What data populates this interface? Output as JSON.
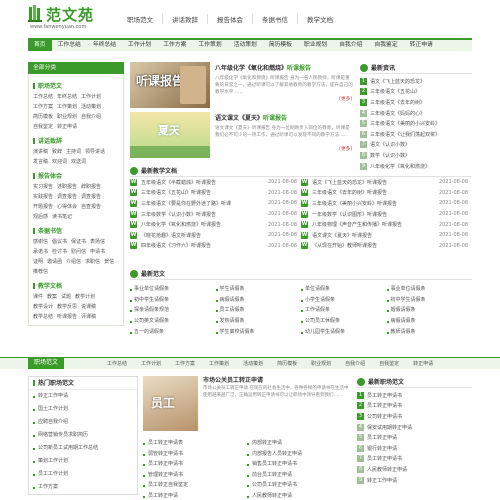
{
  "site": {
    "logo_text": "范文苑",
    "url": "www.fanwenyuan.com"
  },
  "top_nav": [
    "职场范文",
    "讲话致辞",
    "报告体会",
    "条据书信",
    "教学文档"
  ],
  "main_nav": [
    "首页",
    "工作总结",
    "年终总结",
    "工作计划",
    "工作方案",
    "工作策划",
    "活动策划",
    "简历模板",
    "职业规划",
    "自我介绍",
    "自我鉴定",
    "转正申请"
  ],
  "sidebar": {
    "header": "全部分类",
    "categories": [
      {
        "title": "职场范文",
        "items": [
          "工作总结",
          "年终总结",
          "工作计划",
          "工作方案",
          "工作策划",
          "活动策划",
          "简历模板",
          "职业规划",
          "自我介绍",
          "自我鉴定",
          "转正申请"
        ]
      },
      {
        "title": "讲话致辞",
        "items": [
          "演讲稿",
          "致辞",
          "主持词",
          "领导讲话",
          "发言稿",
          "欢迎词",
          "欢送词"
        ]
      },
      {
        "title": "报告体会",
        "items": [
          "实习报告",
          "述职报告",
          "辞职报告",
          "实践报告",
          "调查报告",
          "调查报告",
          "开题报告",
          "心得体会",
          "自查报告",
          "观后感",
          "读书笔记"
        ]
      },
      {
        "title": "条据书信",
        "items": [
          "感谢信",
          "倡议书",
          "保证书",
          "表扬信",
          "承诺书",
          "检讨书",
          "慰问信",
          "申请书",
          "证明",
          "邀请函",
          "介绍信",
          "求职信",
          "贺信",
          "推荐信"
        ]
      },
      {
        "title": "教学文档",
        "items": [
          "课件",
          "教案",
          "试题",
          "教学计划",
          "教学设计",
          "教学反思",
          "说课稿",
          "教学总结",
          "听课报告",
          "评课稿"
        ]
      }
    ]
  },
  "featured": [
    {
      "title_prefix": "八年级化学《氧化和燃烧》",
      "title_suffix": "听课报告",
      "desc": "八年级化学《氧化和燃烧》听课报告 身为一名人民教师，听课是重要的日常之一，通过听课可以了解其他教师的教学方法，提升自己的教学水平……",
      "more": "[更多]",
      "img_text": "听课报告"
    },
    {
      "title_prefix": "语文课文《夏天》",
      "title_suffix": "听课报告",
      "desc": "语文课文《夏天》听课报告 身为一位刚刚步入岗位的教师，听课是我们必不可少的一项工作，通过听课可以发现不同的教学方法……",
      "more": "[更多]",
      "img_text": "夏天"
    }
  ],
  "newest": {
    "title": "最新资讯",
    "items": [
      "语文《飞上蓝天的恐龙》",
      "三年级语文《五花山》",
      "三年级语文《去年的树》",
      "三年级语文《妈妈的心》",
      "三年级语文《美丽的小兴安岭》",
      "三年级语文《让我们荡起双桨》",
      "语文《认识小数》",
      "数学《认识小数》",
      "八年级化学《氧化和燃烧》"
    ]
  },
  "recommend": {
    "title": "最新教学文档",
    "left": [
      {
        "t": "五年级语文《半截蜡烛》听课报告",
        "d": "2021-08-08"
      },
      {
        "t": "三年级语文《五花山》听课报告",
        "d": "2021-08-08"
      },
      {
        "t": "三年级语文《要是你在野外迷了路》听课",
        "d": "2021-08-08"
      },
      {
        "t": "三年级数学《认识小数》听课报告",
        "d": "2021-08-08"
      },
      {
        "t": "八年级化学《氧化和燃烧》听课报告",
        "d": "2021-08-08"
      },
      {
        "t": "《晓花拾趣》语文听课报告",
        "d": "2021-08-08"
      },
      {
        "t": "四年级语文《习作六》听课报告",
        "d": "2021-08-08"
      }
    ],
    "right": [
      {
        "t": "语文《飞上蓝天的恐龙》听课报告",
        "d": "2021-08-08"
      },
      {
        "t": "三年级语文《去年的树》听课报告",
        "d": "2021-08-08"
      },
      {
        "t": "三年级语文《美丽小兴安岭》听课报告",
        "d": "2021-08-08"
      },
      {
        "t": "一年级数学《认识图形》听课报告",
        "d": "2021-08-08"
      },
      {
        "t": "八年级物理《声音产生和传播》听课报告",
        "d": "2021-08-08"
      },
      {
        "t": "语文课文《夏天》听课报告",
        "d": "2021-08-08"
      },
      {
        "t": "《从现在开始》教师听课报告",
        "d": "2021-08-08"
      }
    ]
  },
  "fanwen": {
    "title": "最新范文",
    "items": [
      "事业单位请假条",
      "学生请假条",
      "单位请假条",
      "事业单位请假条",
      "初中学生请假条",
      "病假请假条",
      "小学生请假条",
      "初中学生请假条",
      "探亲请假条规范",
      "员工请假条",
      "工作请假条",
      "婚假请假条",
      "公司英文请假条",
      "发热请假条",
      "公司员工休假条",
      "病假请假条",
      "五一的请假条",
      "学生离校请假条",
      "幼儿园学生请假条",
      "教师请假条"
    ]
  },
  "band": {
    "tag": "职场范文",
    "links": [
      "工作总结",
      "工作计划",
      "工作方案",
      "工作策划",
      "活动策划",
      "简历模板",
      "职业规划",
      "自我介绍",
      "自我鉴定",
      "转正申请"
    ]
  },
  "bottom_left": {
    "title": "热门职场范文",
    "items": [
      "转正工作申请",
      "国土工作计划",
      "应聘自我介绍",
      "网络营销专员求职简历",
      "公司新员工试用期工作总结",
      "策划工作计划",
      "员工工作计划",
      "工作方案"
    ]
  },
  "bottom_mid": {
    "title": "市场公关员工转正申请",
    "desc": "市场公关员工转正申请 在现在的社会生活中，各种各样的申请书在生活中使用越来越广泛，正确运用转正申请书可以让职场中领导看到我们……",
    "img_text": "员工",
    "items": [
      "员工转正申请表",
      "内部转正申请",
      "弱管转正申请书",
      "内部报告人员转正申请",
      "员工转正申请书",
      "销售员工转正申请书",
      "管理转正申请书",
      "前台员工转正申请",
      "员工转正自我鉴定",
      "公司员工转正申请书",
      "员工转正申请",
      "人民教师转正申请"
    ]
  },
  "bottom_right": {
    "title": "最新职场范文",
    "items": [
      "员工转正申请书",
      "员工转正申请书",
      "公司转正申请书",
      "保安试用期转正申请",
      "员工转正申请",
      "银行转正申请",
      "员工转正申请书",
      "人民教师转正申请",
      "转正工作申请"
    ]
  }
}
